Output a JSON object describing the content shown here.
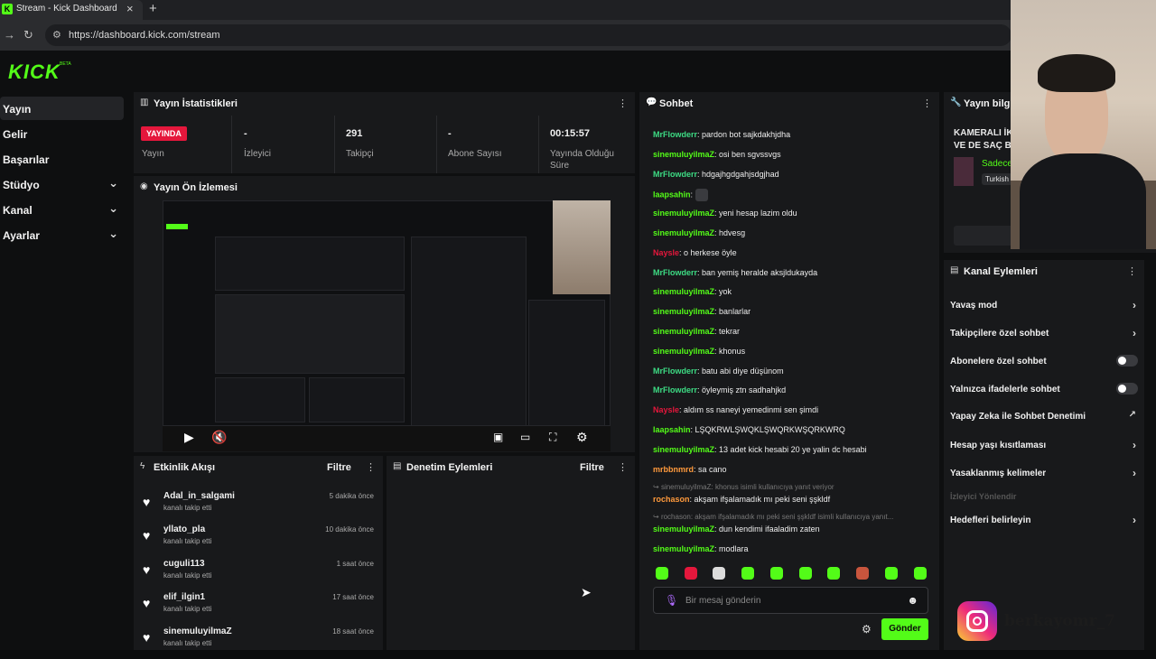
{
  "browser": {
    "tab_title": "Stream - Kick Dashboard",
    "tab_close": "×",
    "new_tab": "+",
    "url": "https://dashboard.kick.com/stream"
  },
  "brand": {
    "logo": "KICK",
    "beta": "BETA"
  },
  "colors": {
    "accent": "#53fc18",
    "live": "#e5173c",
    "panel": "#18191b",
    "background": "#0e0f10"
  },
  "sidebar": {
    "items": [
      {
        "label": "Yayın",
        "active": true,
        "expandable": false
      },
      {
        "label": "Gelir",
        "expandable": false
      },
      {
        "label": "Başarılar",
        "expandable": false
      },
      {
        "label": "Stüdyo",
        "expandable": true
      },
      {
        "label": "Kanal",
        "expandable": true
      },
      {
        "label": "Ayarlar",
        "expandable": true
      }
    ]
  },
  "stats": {
    "title": "Yayın İstatistikleri",
    "live_badge": "YAYINDA",
    "live_label": "Yayın",
    "viewers_value": "-",
    "viewers_label": "İzleyici",
    "followers_value": "291",
    "followers_label": "Takipçi",
    "subs_value": "-",
    "subs_label": "Abone Sayısı",
    "uptime_value": "00:15:57",
    "uptime_label": "Yayında Olduğu Süre"
  },
  "preview": {
    "title": "Yayın Ön İzlemesi"
  },
  "activity": {
    "title": "Etkinlik Akışı",
    "filter": "Filtre",
    "events": [
      {
        "name": "Adal_in_salgami",
        "action": "kanalı takip etti",
        "time": "5 dakika önce"
      },
      {
        "name": "yllato_pla",
        "action": "kanalı takip etti",
        "time": "10 dakika önce"
      },
      {
        "name": "cuguli113",
        "action": "kanalı takip etti",
        "time": "1 saat önce"
      },
      {
        "name": "elif_ilgin1",
        "action": "kanalı takip etti",
        "time": "17 saat önce"
      },
      {
        "name": "sinemuluyilmaZ",
        "action": "kanalı takip etti",
        "time": "18 saat önce"
      }
    ]
  },
  "moderation": {
    "title": "Denetim Eylemleri",
    "filter": "Filtre"
  },
  "chat": {
    "title": "Sohbet",
    "messages": [
      {
        "user": "MrFlowderr",
        "color": "#3ddc84",
        "text": "pardon bot sajkdakhjdha"
      },
      {
        "user": "sinemuluyilmaZ",
        "color": "#53fc18",
        "text": "osi ben sgvssvgs"
      },
      {
        "user": "MrFlowderr",
        "color": "#3ddc84",
        "text": "hdgajhgdgahjsdgjhad"
      },
      {
        "user": "laapsahin",
        "color": "#53fc18",
        "text": ""
      },
      {
        "user": "sinemuluyilmaZ",
        "color": "#53fc18",
        "text": "yeni hesap lazim oldu"
      },
      {
        "user": "sinemuluyilmaZ",
        "color": "#53fc18",
        "text": "hdvesg"
      },
      {
        "user": "Naysle",
        "color": "#e5173c",
        "text": "o herkese öyle"
      },
      {
        "user": "MrFlowderr",
        "color": "#3ddc84",
        "text": "ban yemiş heralde aksjldukayda"
      },
      {
        "user": "sinemuluyilmaZ",
        "color": "#53fc18",
        "text": "yok"
      },
      {
        "user": "sinemuluyilmaZ",
        "color": "#53fc18",
        "text": "banlarlar"
      },
      {
        "user": "sinemuluyilmaZ",
        "color": "#53fc18",
        "text": "tekrar"
      },
      {
        "user": "sinemuluyilmaZ",
        "color": "#53fc18",
        "text": "khonus"
      },
      {
        "user": "MrFlowderr",
        "color": "#3ddc84",
        "text": "batu abi diye düşünom"
      },
      {
        "user": "MrFlowderr",
        "color": "#3ddc84",
        "text": "öyleymiş ztn sadhahjkd"
      },
      {
        "user": "Naysle",
        "color": "#e5173c",
        "text": "aldım ss naneyi yemedinmi sen şimdi"
      },
      {
        "user": "laapsahin",
        "color": "#53fc18",
        "text": "LŞQKRWLŞWQKLŞWQRKWŞQRKWRQ"
      },
      {
        "user": "sinemuluyilmaZ",
        "color": "#53fc18",
        "text": "13 adet kick hesabi 20 ye yalin dc hesabi"
      },
      {
        "user": "mrbbnmrd",
        "color": "#ff9a3c",
        "text": "sa cano"
      }
    ],
    "reply1_ref": "sinemuluyilmaZ: khonus isimli kullanıcıya yanıt veriyor",
    "reply1_user": "rochason",
    "reply1_text": "akşam ifşalamadık mı peki seni şşkldf",
    "reply2_ref": "rochason: akşam ifşalamadık mı peki seni şşkldf isimli kullanıcıya yanıt...",
    "reply2_user": "sinemuluyilmaZ",
    "reply2_text": "dun kendimi ifaaladim zaten",
    "last_user": "sinemuluyilmaZ",
    "last_text": "modlara",
    "input_placeholder": "Bir mesaj gönderin",
    "send_label": "Gönder"
  },
  "stream_info": {
    "title": "Yayın bilgisi",
    "stream_title_line1": "KAMERALI İK",
    "stream_title_line2": "VE DE SAÇ BA",
    "category_prefix": "Sadece",
    "tag": "Turkish"
  },
  "channel_actions": {
    "title": "Kanal Eylemleri",
    "items": [
      {
        "label": "Yavaş mod",
        "control": "chevron"
      },
      {
        "label": "Takipçilere özel sohbet",
        "control": "chevron"
      },
      {
        "label": "Abonelere özel sohbet",
        "control": "toggle"
      },
      {
        "label": "Yalnızca ifadelerle sohbet",
        "control": "toggle"
      },
      {
        "label": "Yapay Zeka ile Sohbet Denetimi",
        "control": "external"
      },
      {
        "label": "Hesap yaşı kısıtlaması",
        "control": "chevron"
      },
      {
        "label": "Yasaklanmış kelimeler",
        "control": "chevron"
      }
    ],
    "redirect_label": "İzleyici Yönlendir",
    "goals_label": "Hedefleri belirleyin"
  },
  "overlay": {
    "watermark": "berkayomr_7"
  }
}
